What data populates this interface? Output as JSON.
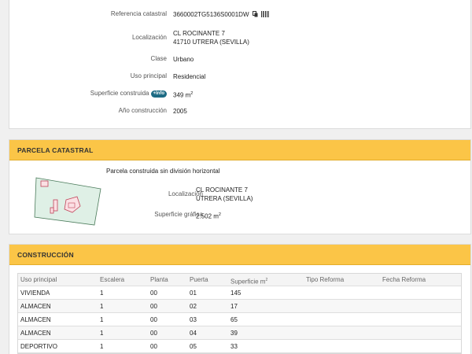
{
  "inmueble": {
    "referencia": {
      "label": "Referencia catastral",
      "value": "3660002TG5136S0001DW"
    },
    "localizacion": {
      "label": "Localización",
      "line1": "CL ROCINANTE 7",
      "line2": "41710 UTRERA (SEVILLA)"
    },
    "clase": {
      "label": "Clase",
      "value": "Urbano"
    },
    "uso": {
      "label": "Uso principal",
      "value": "Residencial"
    },
    "superficie": {
      "label": "Superficie construida",
      "badge": "+Info",
      "value": "349 m",
      "unit_sup": "2"
    },
    "anio": {
      "label": "Año construcción",
      "value": "2005"
    }
  },
  "parcela": {
    "title": "PARCELA CATASTRAL",
    "description": "Parcela construida sin división horizontal",
    "localizacion": {
      "label": "Localización",
      "line1": "CL ROCINANTE 7",
      "line2": "UTRERA (SEVILLA)"
    },
    "superficie": {
      "label": "Superficie gráfica",
      "value": "2.502 m",
      "unit_sup": "2"
    }
  },
  "construccion": {
    "title": "CONSTRUCCIÓN",
    "columns": [
      "Uso principal",
      "Escalera",
      "Planta",
      "Puerta",
      "Superficie m",
      "Tipo Reforma",
      "Fecha Reforma"
    ],
    "superficie_sup": "2",
    "rows": [
      [
        "VIVIENDA",
        "1",
        "00",
        "01",
        "145",
        "",
        ""
      ],
      [
        "ALMACEN",
        "1",
        "00",
        "02",
        "17",
        "",
        ""
      ],
      [
        "ALMACEN",
        "1",
        "00",
        "03",
        "65",
        "",
        ""
      ],
      [
        "ALMACEN",
        "1",
        "00",
        "04",
        "39",
        "",
        ""
      ],
      [
        "DEPORTIVO",
        "1",
        "00",
        "05",
        "33",
        "",
        ""
      ]
    ]
  },
  "icons": {
    "copy": "copy-icon",
    "barcode": "barcode-icon",
    "map": "parcel-map-thumbnail"
  },
  "colors": {
    "header_bg": "#fbc547",
    "badge_bg": "#1d6b84",
    "page_bg": "#f0f0f0"
  }
}
